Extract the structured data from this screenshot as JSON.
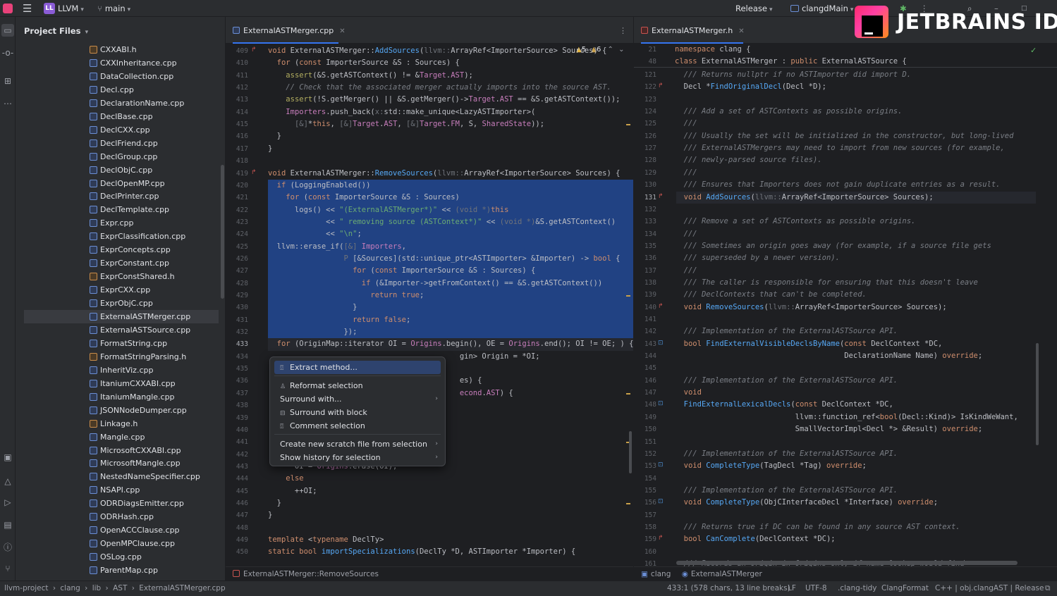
{
  "titlebar": {
    "project_badge": "LL",
    "project_name": "LLVM",
    "branch": "main",
    "run_config": "Release",
    "target": "clangdMain"
  },
  "logo": {
    "text": "JETBRAINS IDE"
  },
  "project_panel": {
    "title": "Project Files",
    "files": [
      {
        "name": "CXXABI.h",
        "kind": "h"
      },
      {
        "name": "CXXInheritance.cpp",
        "kind": "cpp"
      },
      {
        "name": "DataCollection.cpp",
        "kind": "cpp"
      },
      {
        "name": "Decl.cpp",
        "kind": "cpp"
      },
      {
        "name": "DeclarationName.cpp",
        "kind": "cpp"
      },
      {
        "name": "DeclBase.cpp",
        "kind": "cpp"
      },
      {
        "name": "DeclCXX.cpp",
        "kind": "cpp"
      },
      {
        "name": "DeclFriend.cpp",
        "kind": "cpp"
      },
      {
        "name": "DeclGroup.cpp",
        "kind": "cpp"
      },
      {
        "name": "DeclObjC.cpp",
        "kind": "cpp"
      },
      {
        "name": "DeclOpenMP.cpp",
        "kind": "cpp"
      },
      {
        "name": "DeclPrinter.cpp",
        "kind": "cpp"
      },
      {
        "name": "DeclTemplate.cpp",
        "kind": "cpp"
      },
      {
        "name": "Expr.cpp",
        "kind": "cpp"
      },
      {
        "name": "ExprClassification.cpp",
        "kind": "cpp"
      },
      {
        "name": "ExprConcepts.cpp",
        "kind": "cpp"
      },
      {
        "name": "ExprConstant.cpp",
        "kind": "cpp"
      },
      {
        "name": "ExprConstShared.h",
        "kind": "h"
      },
      {
        "name": "ExprCXX.cpp",
        "kind": "cpp"
      },
      {
        "name": "ExprObjC.cpp",
        "kind": "cpp"
      },
      {
        "name": "ExternalASTMerger.cpp",
        "kind": "cpp",
        "selected": true
      },
      {
        "name": "ExternalASTSource.cpp",
        "kind": "cpp"
      },
      {
        "name": "FormatString.cpp",
        "kind": "cpp"
      },
      {
        "name": "FormatStringParsing.h",
        "kind": "h"
      },
      {
        "name": "InheritViz.cpp",
        "kind": "cpp"
      },
      {
        "name": "ItaniumCXXABI.cpp",
        "kind": "cpp"
      },
      {
        "name": "ItaniumMangle.cpp",
        "kind": "cpp"
      },
      {
        "name": "JSONNodeDumper.cpp",
        "kind": "cpp"
      },
      {
        "name": "Linkage.h",
        "kind": "h"
      },
      {
        "name": "Mangle.cpp",
        "kind": "cpp"
      },
      {
        "name": "MicrosoftCXXABI.cpp",
        "kind": "cpp"
      },
      {
        "name": "MicrosoftMangle.cpp",
        "kind": "cpp"
      },
      {
        "name": "NestedNameSpecifier.cpp",
        "kind": "cpp"
      },
      {
        "name": "NSAPI.cpp",
        "kind": "cpp"
      },
      {
        "name": "ODRDiagsEmitter.cpp",
        "kind": "cpp"
      },
      {
        "name": "ODRHash.cpp",
        "kind": "cpp"
      },
      {
        "name": "OpenACCClause.cpp",
        "kind": "cpp"
      },
      {
        "name": "OpenMPClause.cpp",
        "kind": "cpp"
      },
      {
        "name": "OSLog.cpp",
        "kind": "cpp"
      },
      {
        "name": "ParentMap.cpp",
        "kind": "cpp"
      }
    ]
  },
  "left_editor": {
    "tab": "ExternalASTMerger.cpp",
    "warnings": "5",
    "weak_warnings": "6",
    "lines": [
      {
        "n": "409",
        "html": "<span class='kw'>void</span> ExternalASTMerger::<span class='fn'>AddSources</span>(<span class='hint'>llvm::</span>ArrayRef&lt;ImporterSource&gt; Sources) {"
      },
      {
        "n": "410",
        "html": "  <span class='kw'>for</span> (<span class='kw'>const</span> ImporterSource &amp;S : Sources) {"
      },
      {
        "n": "411",
        "html": "    <span class='mac'>assert</span>(&amp;S.getASTContext() != &amp;<span class='fld'>Target</span>.<span class='fld'>AST</span>);"
      },
      {
        "n": "412",
        "html": "    <span class='cmt'>// Check that the associated merger actually imports into the source AST.</span>"
      },
      {
        "n": "413",
        "html": "    <span class='mac'>assert</span>(!S.getMerger() || &amp;S.getMerger()-&gt;<span class='fld'>Target</span>.<span class='fld'>AST</span> == &amp;S.getASTContext());"
      },
      {
        "n": "414",
        "html": "    <span class='fld'>Importers</span>.push_back(<span class='hint'>x:</span>std::make_unique&lt;LazyASTImporter&gt;("
      },
      {
        "n": "415",
        "html": "      <span class='hint'>[&amp;]</span>*<span class='kw'>this</span>, <span class='hint'>[&amp;]</span><span class='fld'>Target</span>.<span class='fld'>AST</span>, <span class='hint'>[&amp;]</span><span class='fld'>Target</span>.<span class='fld'>FM</span>, S, <span class='fld'>SharedState</span>));"
      },
      {
        "n": "416",
        "html": "  }"
      },
      {
        "n": "417",
        "html": "}"
      },
      {
        "n": "418",
        "html": ""
      },
      {
        "n": "419",
        "html": "<span class='kw'>void</span> ExternalASTMerger::<span class='fn'>RemoveSources</span>(<span class='hint'>llvm::</span>ArrayRef&lt;ImporterSource&gt; Sources) {"
      },
      {
        "n": "420",
        "html": "  <span class='kw'>if</span> (LoggingEnabled())"
      },
      {
        "n": "421",
        "html": "    <span class='kw'>for</span> (<span class='kw'>const</span> ImporterSource &amp;S : Sources)"
      },
      {
        "n": "422",
        "html": "      logs() &lt;&lt; <span class='str'>\"(ExternalASTMerger*)\"</span> &lt;&lt; <span class='hint'>(void *)</span><span class='kw'>this</span>"
      },
      {
        "n": "423",
        "html": "             &lt;&lt; <span class='str'>\" removing source (ASTContext*)\"</span> &lt;&lt; <span class='hint'>(void *)</span>&amp;S.getASTContext()"
      },
      {
        "n": "424",
        "html": "             &lt;&lt; <span class='str'>\"\\n\"</span>;"
      },
      {
        "n": "425",
        "html": "  llvm::erase_if(<span class='hint'>[&amp;]</span> <span class='fld'>Importers</span>,"
      },
      {
        "n": "426",
        "html": "                 <span class='hint'>P</span> [&amp;Sources](std::unique_ptr&lt;ASTImporter&gt; &amp;Importer) -&gt; <span class='kw'>bool</span> {"
      },
      {
        "n": "427",
        "html": "                   <span class='kw'>for</span> (<span class='kw'>const</span> ImporterSource &amp;S : Sources) {"
      },
      {
        "n": "428",
        "html": "                     <span class='kw'>if</span> (&amp;Importer-&gt;getFromContext() == &amp;S.getASTContext())"
      },
      {
        "n": "429",
        "html": "                       <span class='kw'>return</span> <span class='kw'>true</span>;"
      },
      {
        "n": "430",
        "html": "                   }"
      },
      {
        "n": "431",
        "html": "                   <span class='kw'>return</span> <span class='kw'>false</span>;"
      },
      {
        "n": "432",
        "html": "                 });"
      },
      {
        "n": "433",
        "html": "  <span class='kw'>for</span> (OriginMap::iterator OI = <span class='fld'>Origins</span>.begin(), OE = <span class='fld'>Origins</span>.end(); OI != OE; ) {"
      },
      {
        "n": "434",
        "html": "                                           gin&gt; Origin = *OI;"
      },
      {
        "n": "435",
        "html": ""
      },
      {
        "n": "436",
        "html": "                                           es) {"
      },
      {
        "n": "437",
        "html": "                                           <span class='fld'>econd</span>.<span class='fld'>AST</span>) {"
      },
      {
        "n": "438",
        "html": ""
      },
      {
        "n": "439",
        "html": ""
      },
      {
        "n": "440",
        "html": ""
      },
      {
        "n": "441",
        "html": ""
      },
      {
        "n": "442",
        "html": ""
      },
      {
        "n": "443",
        "html": "      OI = <span class='fld'>Origins</span>.erase(OI);"
      },
      {
        "n": "444",
        "html": "    <span class='kw'>else</span>"
      },
      {
        "n": "445",
        "html": "      ++OI;"
      },
      {
        "n": "446",
        "html": "  }"
      },
      {
        "n": "447",
        "html": "}"
      },
      {
        "n": "448",
        "html": ""
      },
      {
        "n": "449",
        "html": "<span class='kw'>template</span> &lt;<span class='kw'>typename</span> DeclTy&gt;"
      },
      {
        "n": "450",
        "html": "<span class='kw'>static</span> <span class='kw'>bool</span> <span class='fn'>importSpecializations</span>(DeclTy *D, ASTImporter *Importer) {"
      }
    ],
    "breadcrumb": "ExternalASTMerger::RemoveSources"
  },
  "context_menu": {
    "items": [
      {
        "label": "Extract method...",
        "icon": "wand",
        "active": true
      },
      {
        "label": "Reformat selection",
        "icon": "broom"
      },
      {
        "label": "Surround with...",
        "icon": "",
        "submenu": true
      },
      {
        "label": "Surround with block",
        "icon": "brackets"
      },
      {
        "label": "Comment selection",
        "icon": "wand"
      },
      {
        "label": "Create new scratch file from selection",
        "icon": "",
        "submenu": true
      },
      {
        "label": "Show history for selection",
        "icon": "",
        "submenu": true
      }
    ]
  },
  "right_editor": {
    "tab": "ExternalASTMerger.h",
    "sticky": [
      {
        "n": "21",
        "html": "<span class='kw'>namespace</span> clang {"
      },
      {
        "n": "48",
        "html": "<span class='kw'>class</span> ExternalASTMerger : <span class='kw'>public</span> ExternalASTSource {"
      }
    ],
    "lines": [
      {
        "n": "121",
        "html": "  <span class='cmt'>/// Returns nullptr if no ASTImporter did import D.</span>"
      },
      {
        "n": "122",
        "html": "  Decl *<span class='fn'>FindOriginalDecl</span>(Decl *D);"
      },
      {
        "n": "123",
        "html": ""
      },
      {
        "n": "124",
        "html": "  <span class='cmt'>/// Add a set of ASTContexts as possible origins.</span>"
      },
      {
        "n": "125",
        "html": "  <span class='cmt'>///</span>"
      },
      {
        "n": "126",
        "html": "  <span class='cmt'>/// Usually the set will be initialized in the constructor, but long-lived</span>"
      },
      {
        "n": "127",
        "html": "  <span class='cmt'>/// ExternalASTMergers may need to import from new sources (for example,</span>"
      },
      {
        "n": "128",
        "html": "  <span class='cmt'>/// newly-parsed source files).</span>"
      },
      {
        "n": "129",
        "html": "  <span class='cmt'>///</span>"
      },
      {
        "n": "130",
        "html": "  <span class='cmt'>/// Ensures that Importers does not gain duplicate entries as a result.</span>"
      },
      {
        "n": "131",
        "html": "  <span class='kw'>void</span> <span class='fn'>AddSources</span>(<span class='hint'>llvm::</span>ArrayRef&lt;ImporterSource&gt; Sources);"
      },
      {
        "n": "132",
        "html": ""
      },
      {
        "n": "133",
        "html": "  <span class='cmt'>/// Remove a set of ASTContexts as possible origins.</span>"
      },
      {
        "n": "134",
        "html": "  <span class='cmt'>///</span>"
      },
      {
        "n": "135",
        "html": "  <span class='cmt'>/// Sometimes an origin goes away (for example, if a source file gets</span>"
      },
      {
        "n": "136",
        "html": "  <span class='cmt'>/// superseded by a newer version).</span>"
      },
      {
        "n": "137",
        "html": "  <span class='cmt'>///</span>"
      },
      {
        "n": "138",
        "html": "  <span class='cmt'>/// The caller is responsible for ensuring that this doesn't leave</span>"
      },
      {
        "n": "139",
        "html": "  <span class='cmt'>/// DeclContexts that can't be completed.</span>"
      },
      {
        "n": "140",
        "html": "  <span class='kw'>void</span> <span class='fn'>RemoveSources</span>(<span class='hint'>llvm::</span>ArrayRef&lt;ImporterSource&gt; Sources);"
      },
      {
        "n": "141",
        "html": ""
      },
      {
        "n": "142",
        "html": "  <span class='cmt'>/// Implementation of the ExternalASTSource API.</span>"
      },
      {
        "n": "143",
        "html": "  <span class='kw'>bool</span> <span class='fn'>FindExternalVisibleDeclsByName</span>(<span class='kw'>const</span> DeclContext *DC,"
      },
      {
        "n": "144",
        "html": "                                      DeclarationName Name) <span class='kw'>override</span>;"
      },
      {
        "n": "145",
        "html": ""
      },
      {
        "n": "146",
        "html": "  <span class='cmt'>/// Implementation of the ExternalASTSource API.</span>"
      },
      {
        "n": "147",
        "html": "  <span class='kw'>void</span>"
      },
      {
        "n": "148",
        "html": "  <span class='fn'>FindExternalLexicalDecls</span>(<span class='kw'>const</span> DeclContext *DC,"
      },
      {
        "n": "149",
        "html": "                           llvm::function_ref&lt;<span class='kw'>bool</span>(Decl::Kind)&gt; IsKindWeWant,"
      },
      {
        "n": "150",
        "html": "                           SmallVectorImpl&lt;Decl *&gt; &amp;Result) <span class='kw'>override</span>;"
      },
      {
        "n": "151",
        "html": ""
      },
      {
        "n": "152",
        "html": "  <span class='cmt'>/// Implementation of the ExternalASTSource API.</span>"
      },
      {
        "n": "153",
        "html": "  <span class='kw'>void</span> <span class='fn'>CompleteType</span>(TagDecl *Tag) <span class='kw'>override</span>;"
      },
      {
        "n": "154",
        "html": ""
      },
      {
        "n": "155",
        "html": "  <span class='cmt'>/// Implementation of the ExternalASTSource API.</span>"
      },
      {
        "n": "156",
        "html": "  <span class='kw'>void</span> <span class='fn'>CompleteType</span>(ObjCInterfaceDecl *Interface) <span class='kw'>override</span>;"
      },
      {
        "n": "157",
        "html": ""
      },
      {
        "n": "158",
        "html": "  <span class='cmt'>/// Returns true if DC can be found in any source AST context.</span>"
      },
      {
        "n": "159",
        "html": "  <span class='kw'>bool</span> <span class='fn'>CanComplete</span>(DeclContext *DC);"
      },
      {
        "n": "160",
        "html": ""
      },
      {
        "n": "161",
        "html": "  <span class='cmt'>/// Records an origin in Origins only if name lookup would find</span>"
      }
    ],
    "breadcrumb_ns": "clang",
    "breadcrumb_class": "ExternalASTMerger"
  },
  "statusbar": {
    "crumbs": [
      "llvm-project",
      "clang",
      "lib",
      "AST",
      "ExternalASTMerger.cpp"
    ],
    "position": "433:1 (578 chars, 13 line breaks)",
    "line_sep": "LF",
    "encoding": "UTF-8",
    "linter": ".clang-tidy",
    "formatter": "ClangFormat",
    "language": "C++ | obj.clangAST | Release"
  }
}
